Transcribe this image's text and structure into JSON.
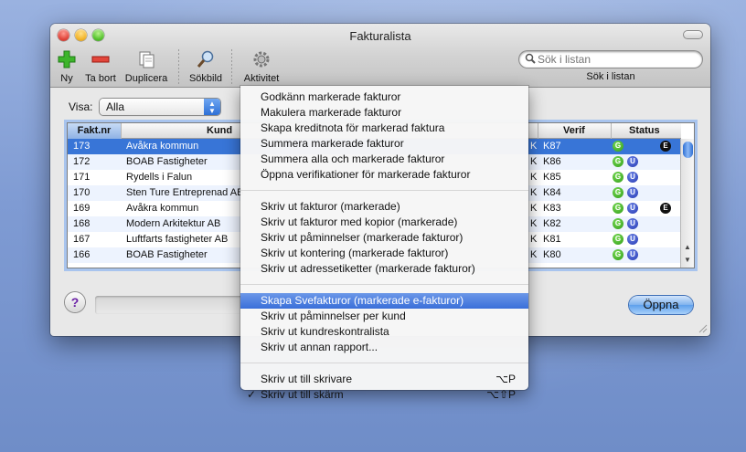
{
  "window": {
    "title": "Fakturalista"
  },
  "toolbar": {
    "items": [
      {
        "label": "Ny"
      },
      {
        "label": "Ta bort"
      },
      {
        "label": "Duplicera"
      },
      {
        "label": "Sökbild"
      },
      {
        "label": "Aktivitet"
      }
    ],
    "search_placeholder": "Sök i listan",
    "search_label": "Sök i listan"
  },
  "filter": {
    "label": "Visa:",
    "value": "Alla"
  },
  "table": {
    "columns": [
      "Fakt.nr",
      "Kund",
      "Verif",
      "Status"
    ],
    "rows": [
      {
        "nr": "173",
        "kund": "Avåkra kommun",
        "k": "K",
        "verif": "K87",
        "badges": [
          "G",
          "E"
        ]
      },
      {
        "nr": "172",
        "kund": "BOAB Fastigheter",
        "k": "K",
        "verif": "K86",
        "badges": [
          "G",
          "U"
        ]
      },
      {
        "nr": "171",
        "kund": "Rydells i Falun",
        "k": "K",
        "verif": "K85",
        "badges": [
          "G",
          "U"
        ]
      },
      {
        "nr": "170",
        "kund": "Sten Ture Entreprenad AB",
        "k": "K",
        "verif": "K84",
        "badges": [
          "G",
          "U"
        ]
      },
      {
        "nr": "169",
        "kund": "Avåkra kommun",
        "k": "K",
        "verif": "K83",
        "badges": [
          "G",
          "U",
          "E"
        ]
      },
      {
        "nr": "168",
        "kund": "Modern Arkitektur AB",
        "k": "K",
        "verif": "K82",
        "badges": [
          "G",
          "U"
        ]
      },
      {
        "nr": "167",
        "kund": "Luftfarts fastigheter AB",
        "k": "K",
        "verif": "K81",
        "badges": [
          "G",
          "U"
        ]
      },
      {
        "nr": "166",
        "kund": "BOAB Fastigheter",
        "k": "K",
        "verif": "K80",
        "badges": [
          "G",
          "U"
        ]
      }
    ]
  },
  "bottom": {
    "help": "?",
    "open_button": "Öppna"
  },
  "menu": {
    "groups": [
      [
        {
          "label": "Godkänn markerade fakturor"
        },
        {
          "label": "Makulera markerade fakturor"
        },
        {
          "label": "Skapa kreditnota för markerad faktura"
        },
        {
          "label": "Summera markerade fakturor"
        },
        {
          "label": "Summera alla och markerade fakturor"
        },
        {
          "label": "Öppna verifikationer för markerade fakturor"
        }
      ],
      [
        {
          "label": "Skriv ut fakturor (markerade)"
        },
        {
          "label": "Skriv ut fakturor med kopior (markerade)"
        },
        {
          "label": "Skriv ut påminnelser (markerade fakturor)"
        },
        {
          "label": "Skriv ut kontering (markerade fakturor)"
        },
        {
          "label": "Skriv ut adressetiketter (markerade fakturor)"
        }
      ],
      [
        {
          "label": "Skapa Svefakturor (markerade e-fakturor)",
          "highlighted": true
        },
        {
          "label": "Skriv ut påminnelser per kund"
        },
        {
          "label": "Skriv ut kundreskontralista"
        },
        {
          "label": "Skriv ut annan rapport..."
        }
      ],
      [
        {
          "label": "Skriv ut till skrivare",
          "shortcut": "⌥P"
        },
        {
          "label": "Skriv ut till skärm",
          "shortcut": "⌥⇧P",
          "checked": true,
          "check": "✓"
        }
      ]
    ]
  }
}
